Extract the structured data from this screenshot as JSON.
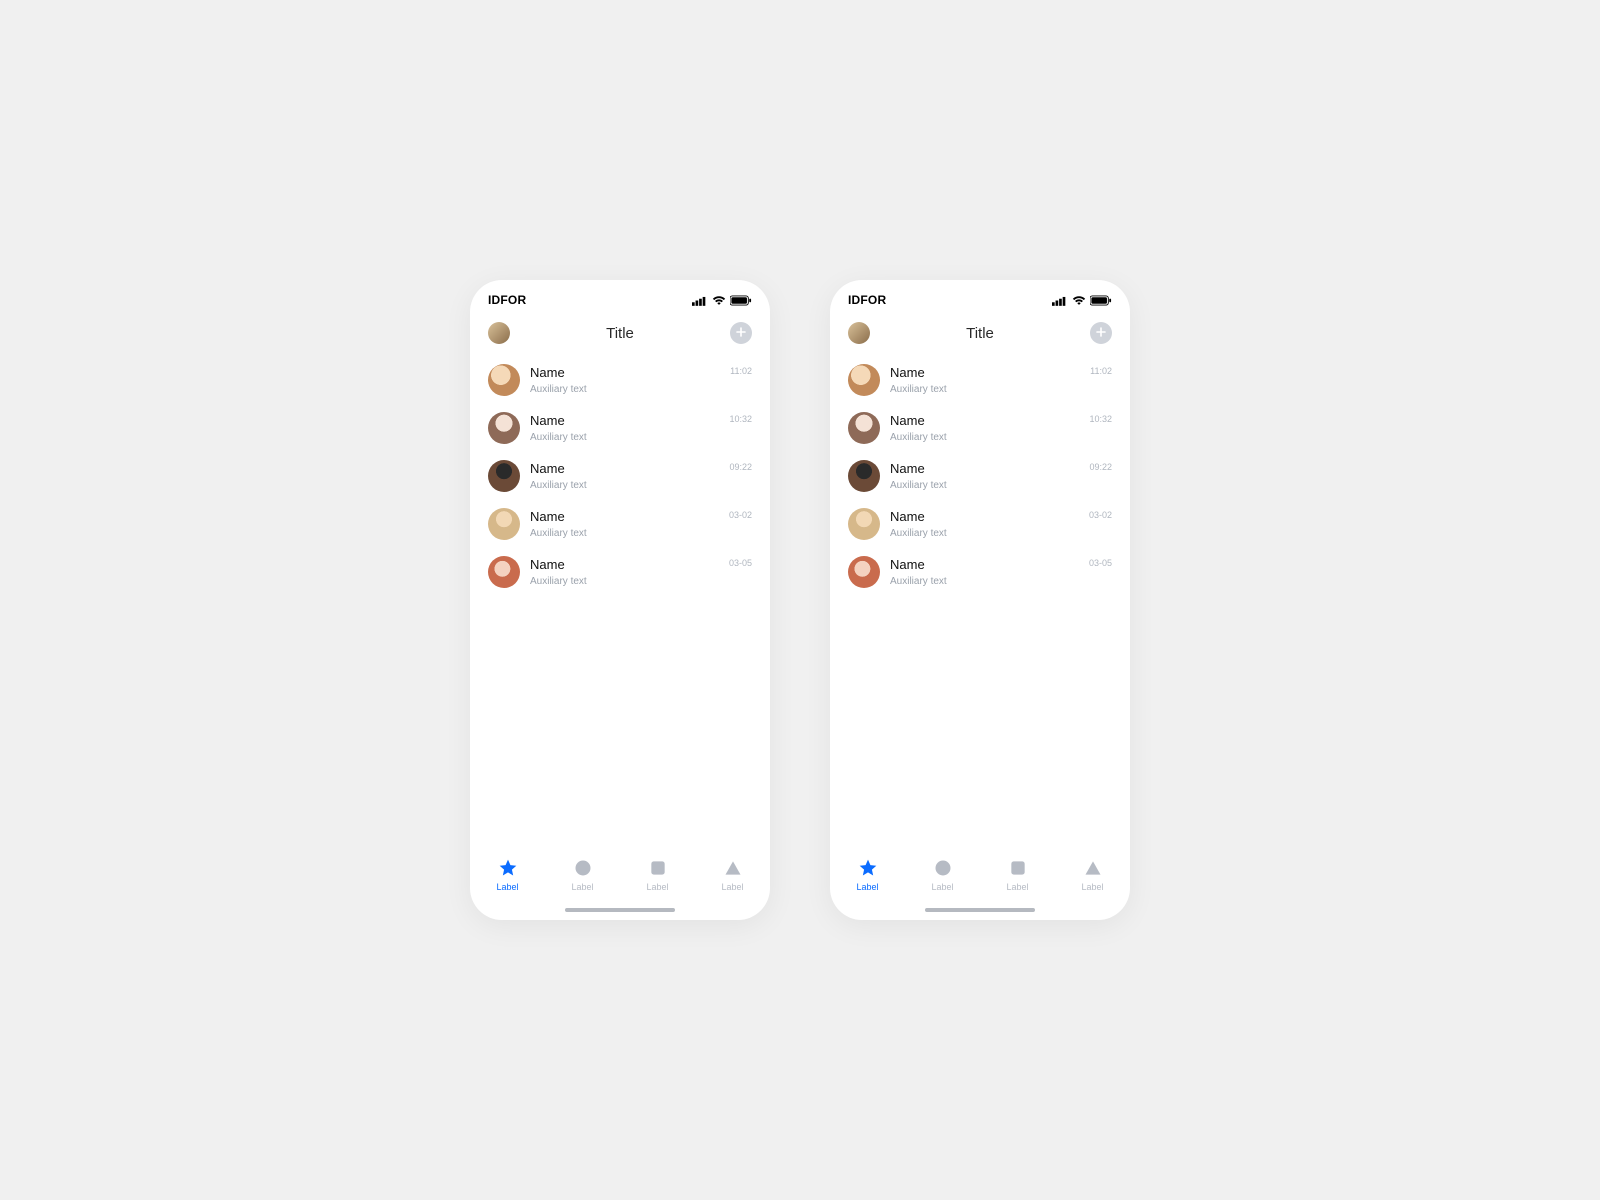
{
  "status": {
    "carrier": "IDFOR"
  },
  "header": {
    "title": "Title"
  },
  "list": {
    "items": [
      {
        "name": "Name",
        "aux": "Auxiliary text",
        "time": "11:02",
        "avatar": "av-1"
      },
      {
        "name": "Name",
        "aux": "Auxiliary text",
        "time": "10:32",
        "avatar": "av-2"
      },
      {
        "name": "Name",
        "aux": "Auxiliary text",
        "time": "09:22",
        "avatar": "av-3"
      },
      {
        "name": "Name",
        "aux": "Auxiliary text",
        "time": "03-02",
        "avatar": "av-4"
      },
      {
        "name": "Name",
        "aux": "Auxiliary text",
        "time": "03-05",
        "avatar": "av-5"
      }
    ]
  },
  "tabs": {
    "items": [
      {
        "label": "Label",
        "icon": "star-icon",
        "active": true
      },
      {
        "label": "Label",
        "icon": "circle-icon",
        "active": false
      },
      {
        "label": "Label",
        "icon": "square-icon",
        "active": false
      },
      {
        "label": "Label",
        "icon": "triangle-icon",
        "active": false
      }
    ]
  }
}
